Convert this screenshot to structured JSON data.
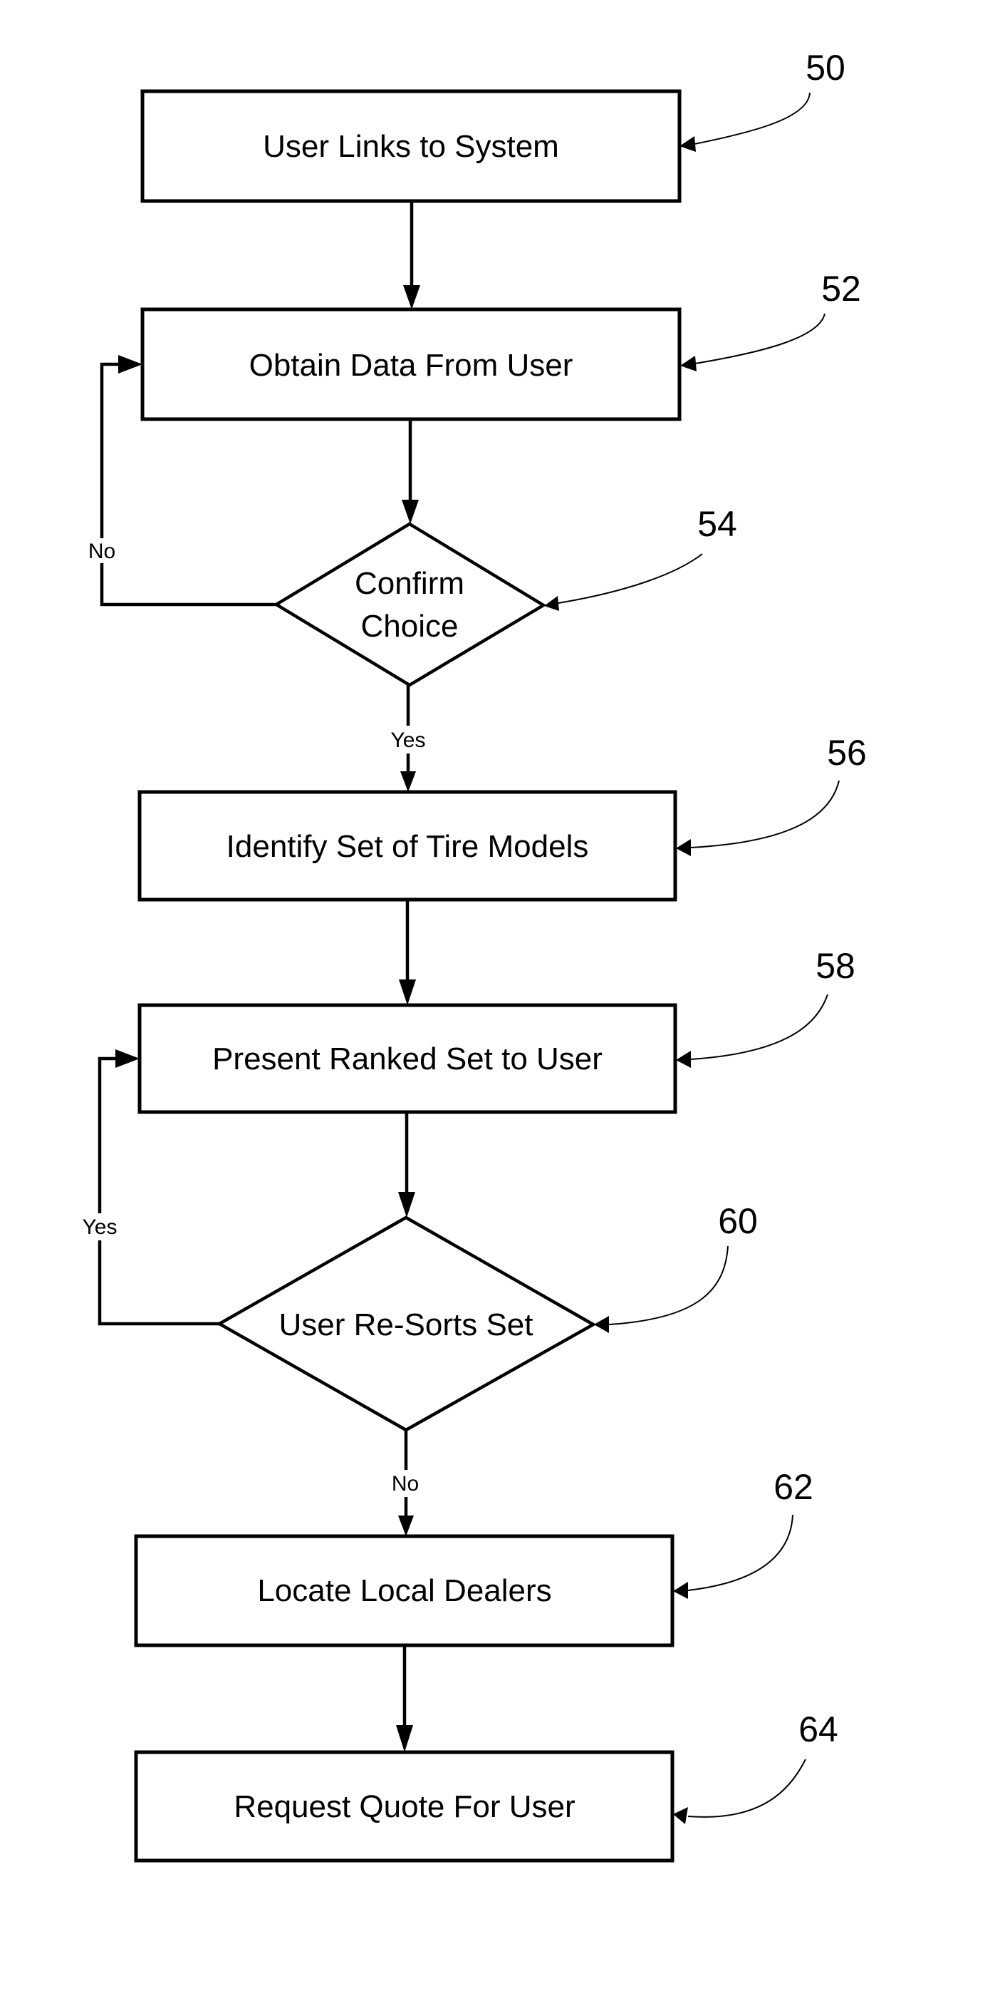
{
  "figure": {
    "type": "flowchart",
    "steps": [
      {
        "ref": "50",
        "kind": "process",
        "label": "User Links to System"
      },
      {
        "ref": "52",
        "kind": "process",
        "label": "Obtain Data From User"
      },
      {
        "ref": "54",
        "kind": "decision",
        "label_lines": [
          "Confirm",
          "Choice"
        ]
      },
      {
        "ref": "56",
        "kind": "process",
        "label": "Identify Set of Tire Models"
      },
      {
        "ref": "58",
        "kind": "process",
        "label": "Present Ranked Set to User"
      },
      {
        "ref": "60",
        "kind": "decision",
        "label_lines": [
          "User Re-Sorts Set"
        ]
      },
      {
        "ref": "62",
        "kind": "process",
        "label": "Locate Local Dealers"
      },
      {
        "ref": "64",
        "kind": "process",
        "label": "Request Quote For User"
      }
    ],
    "branches": {
      "confirm_no": "No",
      "confirm_yes": "Yes",
      "resort_yes": "Yes",
      "resort_no": "No"
    },
    "edges": [
      {
        "from": "50",
        "to": "52"
      },
      {
        "from": "52",
        "to": "54"
      },
      {
        "from": "54",
        "to": "52",
        "label": "No"
      },
      {
        "from": "54",
        "to": "56",
        "label": "Yes"
      },
      {
        "from": "56",
        "to": "58"
      },
      {
        "from": "58",
        "to": "60"
      },
      {
        "from": "60",
        "to": "58",
        "label": "Yes"
      },
      {
        "from": "60",
        "to": "62",
        "label": "No"
      },
      {
        "from": "62",
        "to": "64"
      }
    ]
  }
}
